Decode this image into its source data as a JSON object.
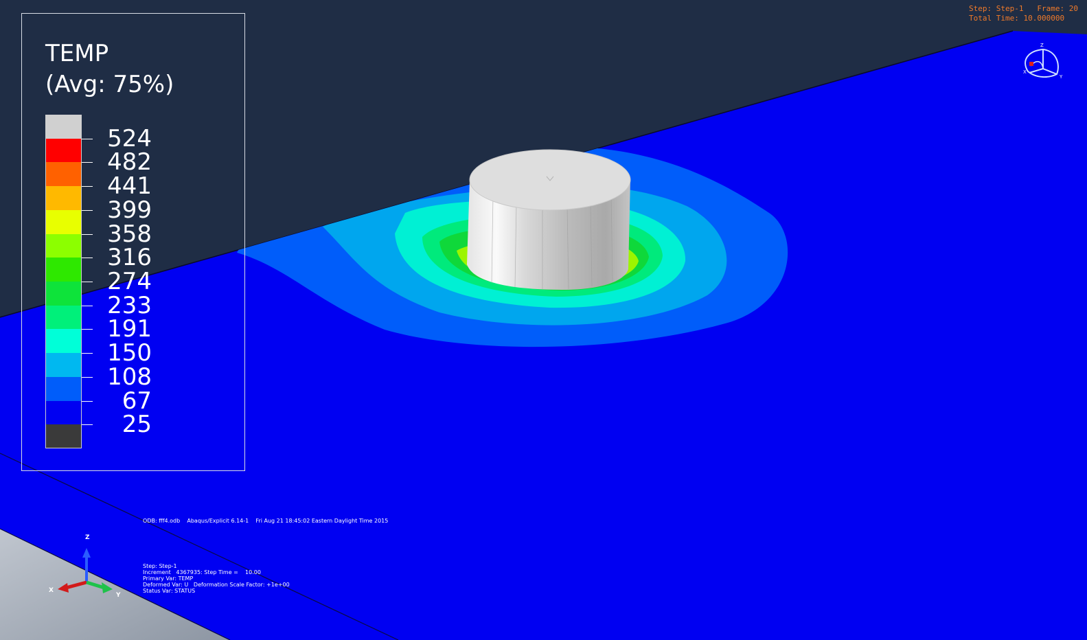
{
  "legend": {
    "title_line1": "TEMP",
    "title_line2": "(Avg: 75%)",
    "levels": [
      "524",
      "482",
      "441",
      "399",
      "358",
      "316",
      "274",
      "233",
      "191",
      "150",
      "108",
      "67",
      "25"
    ],
    "band_colors": [
      "#d0d0d0",
      "#ff0000",
      "#ff6100",
      "#ffb900",
      "#e8ff00",
      "#8cff00",
      "#2ee800",
      "#0ee33a",
      "#00f07a",
      "#00ffd8",
      "#00b8f0",
      "#005dfa",
      "#0000f2",
      "#3a3a3a"
    ]
  },
  "status": {
    "step_line": "Step: Step-1   Frame: 20",
    "time_line": "Total Time: 10.000000"
  },
  "info": {
    "odb_line": "ODB: fff4.odb    Abaqus/Explicit 6.14-1    Fri Aug 21 18:45:02 Eastern Daylight Time 2015",
    "step": "Step: Step-1",
    "increment": "Increment   4367935: Step Time =    10.00",
    "primary_var": "Primary Var: TEMP",
    "deformed_var": "Deformed Var: U   Deformation Scale Factor: +1e+00",
    "status_var": "Status Var: STATUS"
  },
  "triad": {
    "x": "X",
    "y": "Y",
    "z": "Z"
  },
  "colors": {
    "background": "#1f2d45",
    "plate": "#0000f2",
    "cylinder": "#dcdcdc",
    "status_text": "#f07a2a"
  },
  "icons": [
    "view-cube-icon",
    "axis-triad-icon"
  ]
}
